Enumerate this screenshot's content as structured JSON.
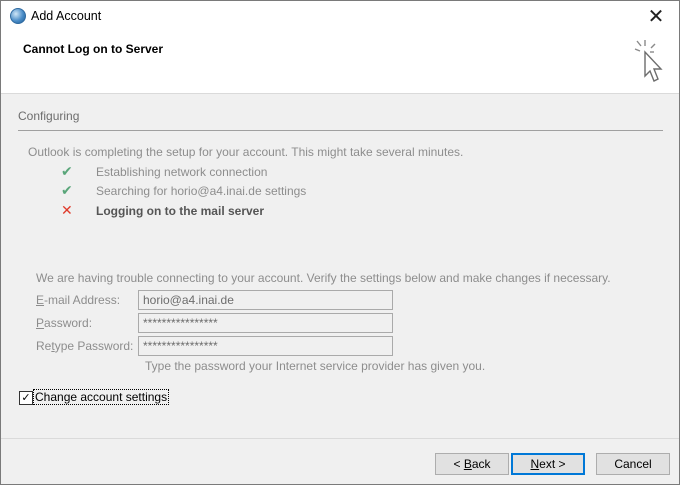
{
  "window": {
    "title": "Add Account",
    "close_glyph": "✕"
  },
  "header": {
    "title": "Cannot Log on to Server",
    "icon": "mouse-pointer-click-icon"
  },
  "section": {
    "title": "Configuring"
  },
  "progress": {
    "intro": "Outlook is completing the setup for your account. This might take several minutes.",
    "steps": [
      {
        "status": "done",
        "label": "Establishing network connection"
      },
      {
        "status": "done",
        "label": "Searching for horio@a4.inai.de settings"
      },
      {
        "status": "failed",
        "label": "Logging on to the mail server"
      }
    ]
  },
  "settings": {
    "message": "We are having trouble connecting to your account. Verify the settings below and make changes if necessary.",
    "email": {
      "label_accel": "E",
      "label_rest": "-mail Address:",
      "value": "horio@a4.inai.de"
    },
    "password": {
      "label_accel": "P",
      "label_rest": "assword:",
      "value": "****************"
    },
    "retype": {
      "label_pre": "Re",
      "label_accel": "t",
      "label_rest": "ype Password:",
      "value": "****************"
    },
    "hint": "Type the password your Internet service provider has given you."
  },
  "change_settings": {
    "label": "Change account settings",
    "checked": true
  },
  "buttons": {
    "back_pre": "< ",
    "back_accel": "B",
    "back_rest": "ack",
    "next_accel": "N",
    "next_rest": "ext >",
    "cancel": "Cancel"
  },
  "colors": {
    "check_ok": "#5aa67a",
    "cross_fail": "#e03a2a",
    "default_button_border": "#0078d7"
  }
}
